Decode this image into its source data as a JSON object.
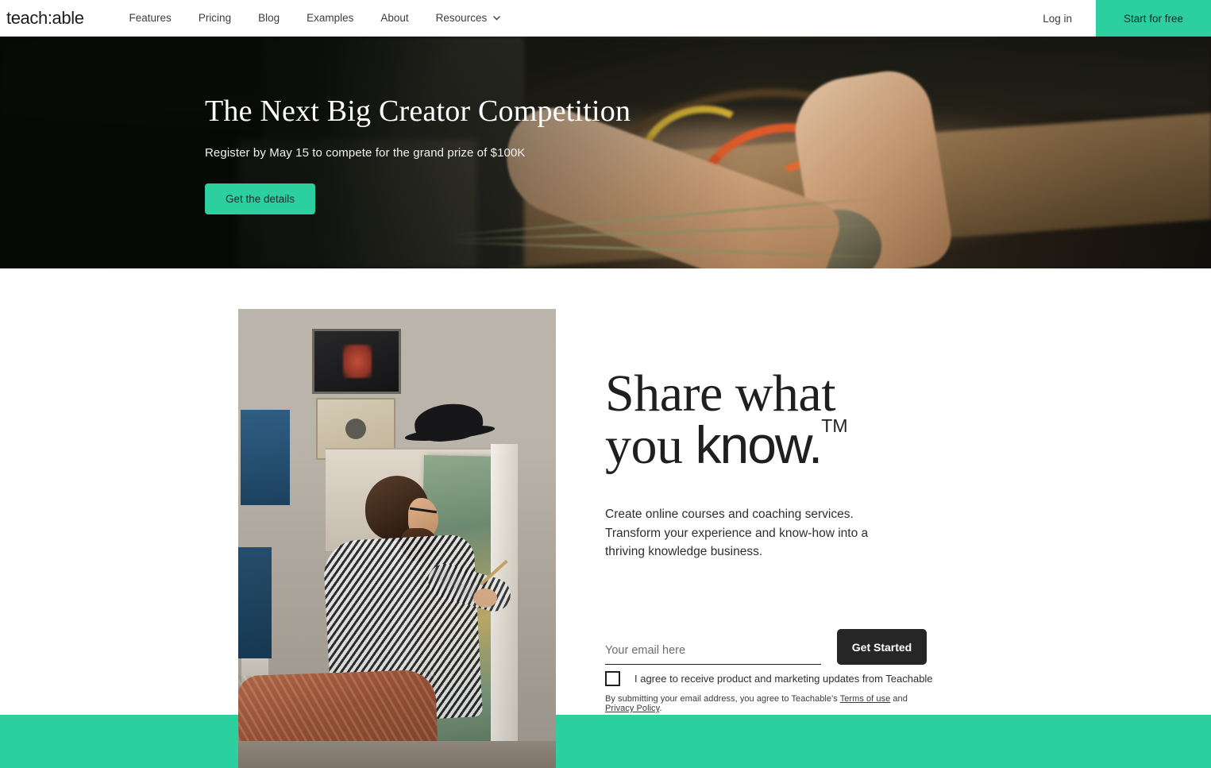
{
  "brand": {
    "logo_text": "teach:able",
    "accent_green": "#2BD09E",
    "dark": "#262626"
  },
  "header": {
    "nav_items": [
      {
        "label": "Features",
        "has_dropdown": false
      },
      {
        "label": "Pricing",
        "has_dropdown": false
      },
      {
        "label": "Blog",
        "has_dropdown": false
      },
      {
        "label": "Examples",
        "has_dropdown": false
      },
      {
        "label": "About",
        "has_dropdown": false
      },
      {
        "label": "Resources",
        "has_dropdown": true,
        "icon": "chevron-down-icon"
      }
    ],
    "login_label": "Log in",
    "start_free_label": "Start for free"
  },
  "hero": {
    "title": "The Next Big Creator Competition",
    "subtitle": "Register by May 15 to compete for the grand prize of $100K",
    "cta_label": "Get the details"
  },
  "main": {
    "headline_line1": "Share what",
    "headline_line2_serif": "you ",
    "headline_line2_sans": "know.",
    "headline_tm": "TM",
    "lede": "Create online courses and coaching services. Transform your experience and know-how into a thriving knowledge business.",
    "form": {
      "email_placeholder": "Your email here",
      "email_value": "",
      "submit_label": "Get Started",
      "consent_checked": false,
      "consent_label": "I agree to receive product and marketing updates from Teachable",
      "fineprint_prefix": "By submitting your email address, you agree to Teachable's ",
      "fineprint_link1": "Terms of use",
      "fineprint_middle": " and ",
      "fineprint_link2": "Privacy Policy",
      "fineprint_suffix": "."
    }
  }
}
